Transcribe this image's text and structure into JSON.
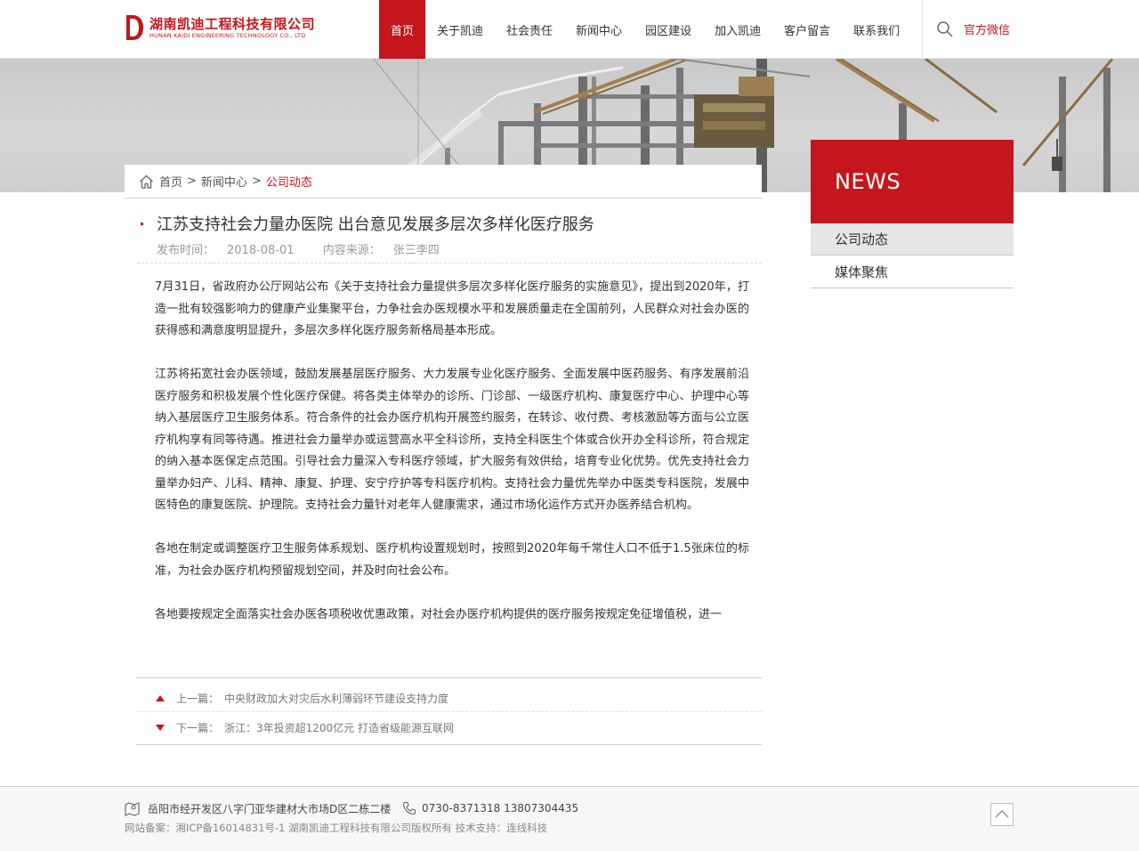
{
  "header": {
    "logo_cn": "湖南凯迪工程科技有限公司",
    "logo_en": "HUNAN KAIDI ENGINEERING TECHNOLOGY CO., LTD",
    "nav": [
      "首页",
      "关于凯迪",
      "社会责任",
      "新闻中心",
      "园区建设",
      "加入凯迪",
      "客户留言",
      "联系我们"
    ],
    "wechat": "官方微信"
  },
  "breadcrumb": {
    "home": "首页",
    "sep1": ">",
    "section": "新闻中心",
    "sep2": ">",
    "current": "公司动态"
  },
  "article": {
    "title": "江苏支持社会力量办医院 出台意见发展多层次多样化医疗服务",
    "date_label": "发布时间：",
    "date": "2018-08-01",
    "source_label": "内容来源：",
    "source": "张三李四",
    "paragraphs": [
      "7月31日，省政府办公厅网站公布《关于支持社会力量提供多层次多样化医疗服务的实施意见》，提出到2020年，打造一批有较强影响力的健康产业集聚平台，力争社会办医规模水平和发展质量走在全国前列，人民群众对社会办医的获得感和满意度明显提升，多层次多样化医疗服务新格局基本形成。",
      "江苏将拓宽社会办医领域，鼓励发展基层医疗服务、大力发展专业化医疗服务、全面发展中医药服务、有序发展前沿医疗服务和积极发展个性化医疗保健。将各类主体举办的诊所、门诊部、一级医疗机构、康复医疗中心、护理中心等纳入基层医疗卫生服务体系。符合条件的社会办医疗机构开展签约服务，在转诊、收付费、考核激励等方面与公立医疗机构享有同等待遇。推进社会力量举办或运营高水平全科诊所，支持全科医生个体或合伙开办全科诊所，符合规定的纳入基本医保定点范围。引导社会力量深入专科医疗领域，扩大服务有效供给，培育专业化优势。优先支持社会力量举办妇产、儿科、精神、康复、护理、安宁疗护等专科医疗机构。支持社会力量优先举办中医类专科医院，发展中医特色的康复医院、护理院。支持社会力量针对老年人健康需求，通过市场化运作方式开办医养结合机构。",
      "各地在制定或调整医疗卫生服务体系规划、医疗机构设置规划时，按照到2020年每千常住人口不低于1.5张床位的标准，为社会办医疗机构预留规划空间，并及时向社会公布。",
      "各地要按规定全面落实社会办医各项税收优惠政策，对社会办医疗机构提供的医疗服务按规定免征增值税，进一"
    ],
    "prev_label": "上一篇：",
    "prev_title": "中央财政加大对灾后水利薄弱环节建设支持力度",
    "next_label": "下一篇：",
    "next_title": "浙江：3年投资超1200亿元 打造省级能源互联网"
  },
  "sidebar": {
    "heading": "NEWS",
    "items": [
      "公司动态",
      "媒体聚焦"
    ]
  },
  "footer": {
    "address": "岳阳市经开发区八字门亚华建材大市场D区二栋二楼",
    "phone": "0730-8371318 13807304435",
    "copyright": "网站备案：湘ICP备16014831号-1   湖南凯迪工程科技有限公司版权所有  技术支持：连线科技"
  },
  "colors": {
    "brand_red": "#c4161c",
    "sidebar_active_bg": "#e6e6e6"
  }
}
